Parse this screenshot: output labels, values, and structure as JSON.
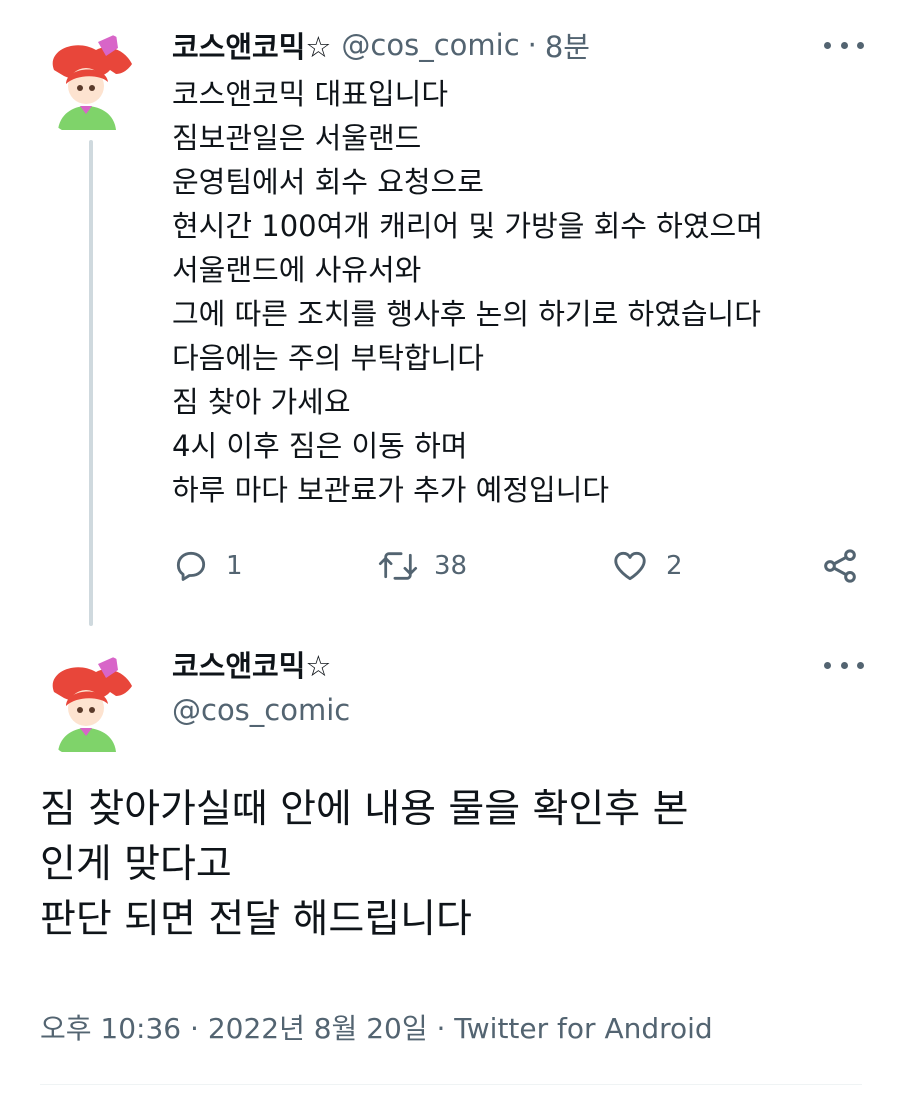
{
  "tweet1": {
    "author_name": "코스앤코믹☆",
    "handle": "@cos_comic",
    "dot": "·",
    "time": "8분",
    "lines": [
      "코스앤코믹 대표입니다",
      "짐보관일은 서울랜드",
      "운영팀에서 회수 요청으로",
      "현시간 100여개 캐리어 및 가방을 회수 하였으며",
      "서울랜드에 사유서와",
      "그에 따른 조치를 행사후 논의 하기로 하였습니다",
      "다음에는 주의 부탁합니다",
      "짐 찾아 가세요",
      "4시 이후 짐은 이동 하며",
      "하루 마다 보관료가 추가 예정입니다"
    ],
    "actions": {
      "reply_icon": "reply-icon",
      "reply_count": "1",
      "retweet_icon": "retweet-icon",
      "retweet_count": "38",
      "like_icon": "heart-icon",
      "like_count": "2",
      "share_icon": "share-icon"
    }
  },
  "tweet2": {
    "author_name": "코스앤코믹☆",
    "handle": "@cos_comic",
    "lines": [
      "짐 찾아가실때 안에 내용 물을 확인후 본",
      "인게 맞다고",
      "판단 되면 전달 해드립니다"
    ],
    "meta": "오후 10:36 · 2022년 8월 20일 · Twitter for Android"
  },
  "colors": {
    "text": "#0f1419",
    "secondary": "#536471",
    "thread_line": "#cfd9de",
    "avatar_hair": "#e8463a",
    "avatar_bow": "#d865c8",
    "avatar_outfit": "#7fd36a"
  }
}
